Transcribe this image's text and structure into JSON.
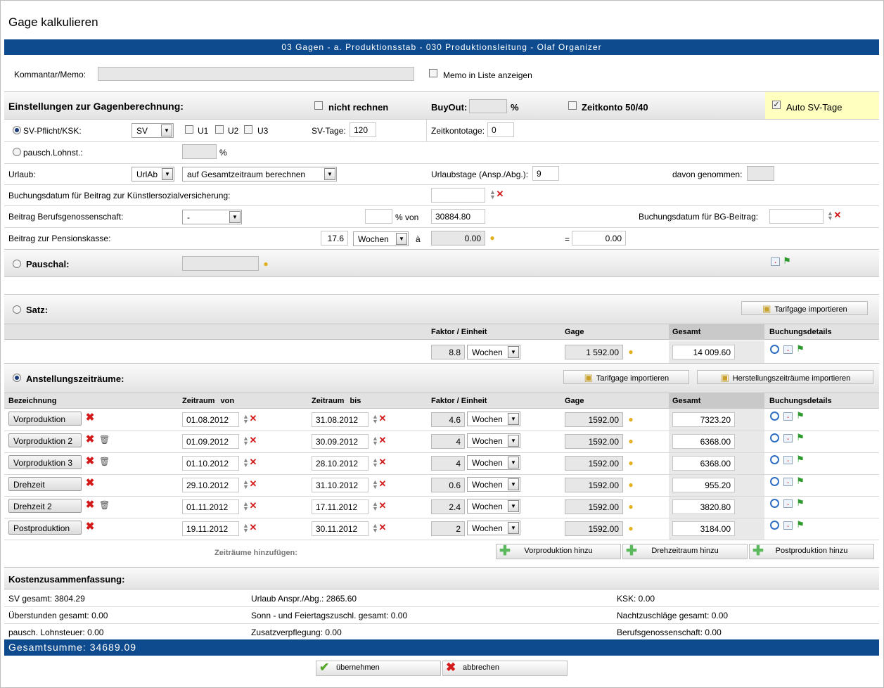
{
  "page_title": "Gage kalkulieren",
  "header_band": "03 Gagen - a. Produktionsstab - 030 Produktionsleitung - Olaf Organizer",
  "memo": {
    "label": "Kommantar/Memo:",
    "value": "",
    "show_label": "Memo in Liste anzeigen"
  },
  "settings": {
    "title": "Einstellungen zur Gagenberechnung:",
    "nicht_rechnen": "nicht rechnen",
    "buyout_label": "BuyOut:",
    "buyout_value": "",
    "percent": "%",
    "zeitkonto": "Zeitkonto 50/40",
    "auto_sv": "Auto SV-Tage",
    "auto_sv_checked": true
  },
  "sv": {
    "label": "SV-Pflicht/KSK:",
    "select": "SV",
    "u1": "U1",
    "u2": "U2",
    "u3": "U3",
    "sv_tage_label": "SV-Tage:",
    "sv_tage_value": "120",
    "zeitkontotage_label": "Zeitkontotage:",
    "zeitkontotage_value": "0"
  },
  "pausch": {
    "label": "pausch.Lohnst.:",
    "value": "",
    "percent": "%"
  },
  "urlaub": {
    "label": "Urlaub:",
    "select1": "UrlAb",
    "select2": "auf Gesamtzeitraum berechnen",
    "tage_label": "Urlaubstage (Ansp./Abg.):",
    "tage_value": "9",
    "genommen_label": "davon genommen:",
    "genommen_value": ""
  },
  "ksk": {
    "label": "Buchungsdatum für Beitrag zur Künstlersozialversicherung:",
    "value": ""
  },
  "bg": {
    "label": "Beitrag Berufsgenossenschaft:",
    "select": "-",
    "percent_value": "",
    "percent_label": "% von",
    "base": "30884.80",
    "date_label": "Buchungsdatum für BG-Beitrag:",
    "date_value": ""
  },
  "pension": {
    "label": "Beitrag zur Pensionskasse:",
    "factor": "17.6",
    "unit": "Wochen",
    "a": "à",
    "rate": "0.00",
    "eq": "=",
    "total": "0.00"
  },
  "pauschal": {
    "label": "Pauschal:",
    "value": ""
  },
  "satz": {
    "label": "Satz:",
    "import_button": "Tarifgage importieren",
    "headers": {
      "faktor": "Faktor / Einheit",
      "gage": "Gage",
      "gesamt": "Gesamt",
      "details": "Buchungsdetails"
    },
    "row": {
      "factor": "8.8",
      "unit": "Wochen",
      "gage": "1 592.00",
      "gesamt": "14 009.60"
    }
  },
  "anstellung": {
    "label": "Anstellungszeiträume:",
    "import_tarif": "Tarifgage importieren",
    "import_herstellung": "Herstellungszeiträume importieren",
    "headers": {
      "bezeichnung": "Bezeichnung",
      "von": "Zeitraum von",
      "bis": "Zeitraum bis",
      "faktor": "Faktor / Einheit",
      "gage": "Gage",
      "gesamt": "Gesamt",
      "details": "Buchungsdetails"
    },
    "rows": [
      {
        "name": "Vorproduktion",
        "von": "01.08.2012",
        "bis": "31.08.2012",
        "factor": "4.6",
        "unit": "Wochen",
        "gage": "1592.00",
        "gesamt": "7323.20"
      },
      {
        "name": "Vorproduktion 2",
        "von": "01.09.2012",
        "bis": "30.09.2012",
        "factor": "4",
        "unit": "Wochen",
        "gage": "1592.00",
        "gesamt": "6368.00"
      },
      {
        "name": "Vorproduktion 3",
        "von": "01.10.2012",
        "bis": "28.10.2012",
        "factor": "4",
        "unit": "Wochen",
        "gage": "1592.00",
        "gesamt": "6368.00"
      },
      {
        "name": "Drehzeit",
        "von": "29.10.2012",
        "bis": "31.10.2012",
        "factor": "0.6",
        "unit": "Wochen",
        "gage": "1592.00",
        "gesamt": "955.20"
      },
      {
        "name": "Drehzeit 2",
        "von": "01.11.2012",
        "bis": "17.11.2012",
        "factor": "2.4",
        "unit": "Wochen",
        "gage": "1592.00",
        "gesamt": "3820.80"
      },
      {
        "name": "Postproduktion",
        "von": "19.11.2012",
        "bis": "30.11.2012",
        "factor": "2",
        "unit": "Wochen",
        "gage": "1592.00",
        "gesamt": "3184.00"
      }
    ],
    "add_label": "Zeiträume hinzufügen:",
    "add_vor": "Vorproduktion hinzu",
    "add_dreh": "Drehzeitraum hinzu",
    "add_post": "Postproduktion hinzu"
  },
  "summary": {
    "title": "Kostenzusammenfassung:",
    "sv_gesamt": "SV gesamt: 3804.29",
    "urlaub": "Urlaub Anspr./Abg.: 2865.60",
    "ksk": "KSK: 0.00",
    "ueberstunden": "Überstunden gesamt: 0.00",
    "sonn": "Sonn - und Feiertagszuschl. gesamt: 0.00",
    "nacht": "Nachtzuschläge gesamt: 0.00",
    "pausch": "pausch. Lohnsteuer: 0.00",
    "zusatz": "Zusatzverpflegung: 0.00",
    "berufs": "Berufsgenossenschaft: 0.00",
    "total": "Gesamtsumme: 34689.09"
  },
  "footer": {
    "ok": "übernehmen",
    "cancel": "abbrechen"
  },
  "colors": {
    "blue_band": "#0e4b8e",
    "highlight": "#ffffc0",
    "gesamt_column": "#c9c9c9"
  }
}
